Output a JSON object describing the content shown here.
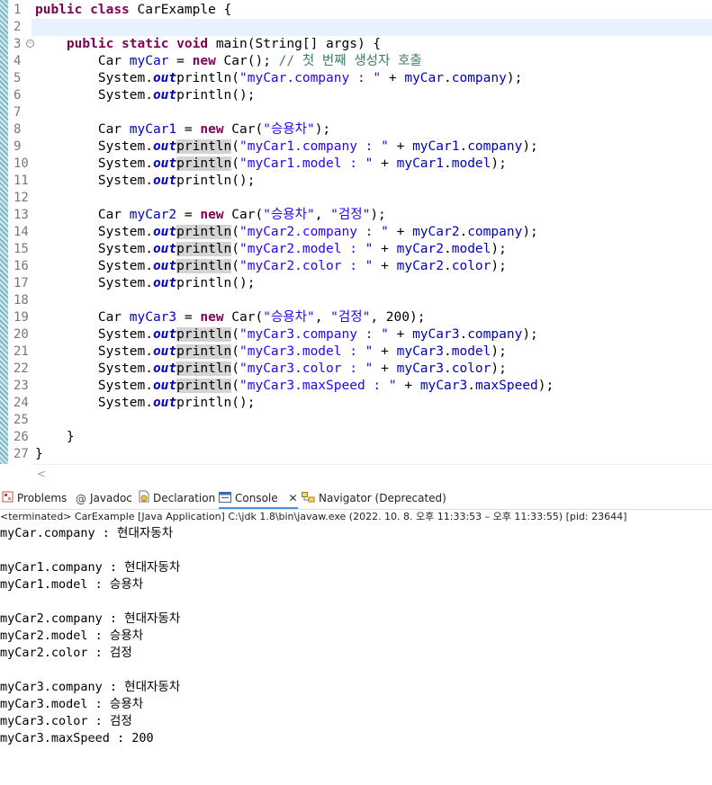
{
  "editor": {
    "line_numbers": [
      "1",
      "2",
      "3",
      "4",
      "5",
      "6",
      "7",
      "8",
      "9",
      "10",
      "11",
      "12",
      "13",
      "14",
      "15",
      "16",
      "17",
      "18",
      "19",
      "20",
      "21",
      "22",
      "23",
      "24",
      "25",
      "26",
      "27"
    ],
    "l1": {
      "kw1": "public",
      "kw2": "class",
      "name": "CarExample {"
    },
    "l3": {
      "kw1": "public",
      "kw2": "static",
      "kw3": "void",
      "rest": "main(String[] args) {"
    },
    "l4": {
      "a": "Car ",
      "var": "myCar",
      "b": " = ",
      "kw": "new",
      "c": " Car(); ",
      "comment": "// 첫 번째 생성자 호출"
    },
    "sys": "System.",
    "out": "out",
    ".": ".",
    "println": "println",
    "println_plain": "println",
    "l5": {
      "str": "\"myCar.company : \"",
      "plus": " + ",
      "var": "myCar",
      "dot": ".",
      "field": "company",
      "end": ");"
    },
    "l8": {
      "a": "Car ",
      "var": "myCar1",
      "b": " = ",
      "kw": "new",
      "c": " Car(",
      "str": "\"승용차\"",
      "end": ");"
    },
    "l9": {
      "str": "\"myCar1.company : \"",
      "var": "myCar1",
      "field": "company"
    },
    "l10": {
      "str": "\"myCar1.model : \"",
      "var": "myCar1",
      "field": "model"
    },
    "l13": {
      "a": "Car ",
      "var": "myCar2",
      "b": " = ",
      "kw": "new",
      "c": " Car(",
      "str1": "\"승용차\"",
      "comma": ", ",
      "str2": "\"검정\"",
      "end": ");"
    },
    "l14": {
      "str": "\"myCar2.company : \"",
      "var": "myCar2",
      "field": "company"
    },
    "l15": {
      "str": "\"myCar2.model : \"",
      "var": "myCar2",
      "field": "model"
    },
    "l16": {
      "str": "\"myCar2.color : \"",
      "var": "myCar2",
      "field": "color"
    },
    "l19": {
      "a": "Car ",
      "var": "myCar3",
      "b": " = ",
      "kw": "new",
      "c": " Car(",
      "str1": "\"승용차\"",
      "comma": ", ",
      "str2": "\"검정\"",
      "d": ", 200);"
    },
    "l20": {
      "str": "\"myCar3.company : \"",
      "var": "myCar3",
      "field": "company"
    },
    "l21": {
      "str": "\"myCar3.model : \"",
      "var": "myCar3",
      "field": "model"
    },
    "l22": {
      "str": "\"myCar3.color : \"",
      "var": "myCar3",
      "field": "color"
    },
    "l23": {
      "str": "\"myCar3.maxSpeed : \"",
      "var": "myCar3",
      "field": "maxSpeed"
    },
    "blank_println": "System.",
    "close_method": "}",
    "close_class": "}"
  },
  "tabs": [
    {
      "label": "Problems",
      "icon": "problems-icon"
    },
    {
      "label": "Javadoc",
      "icon": "at-icon"
    },
    {
      "label": "Declaration",
      "icon": "declaration-icon"
    },
    {
      "label": "Console",
      "icon": "console-icon"
    },
    {
      "label": "Navigator (Deprecated)",
      "icon": "navigator-icon"
    }
  ],
  "status": "<terminated> CarExample [Java Application] C:\\jdk 1.8\\bin\\javaw.exe  (2022. 10. 8. 오후 11:33:53 – 오후 11:33:55) [pid: 23644]",
  "console_lines": [
    "myCar.company : 현대자동차",
    "",
    "myCar1.company : 현대자동차",
    "myCar1.model : 승용차",
    "",
    "myCar2.company : 현대자동차",
    "myCar2.model : 승용차",
    "myCar2.color : 검정",
    "",
    "myCar3.company : 현대자동차",
    "myCar3.model : 승용차",
    "myCar3.color : 검정",
    "myCar3.maxSpeed : 200"
  ],
  "colors": {
    "keyword": "#7f0055",
    "string": "#2a00ff",
    "field": "#0000c0",
    "comment": "#3f7f5f",
    "current_line": "#e8f2fe",
    "console_tab_underline": "#4a8fdf"
  }
}
